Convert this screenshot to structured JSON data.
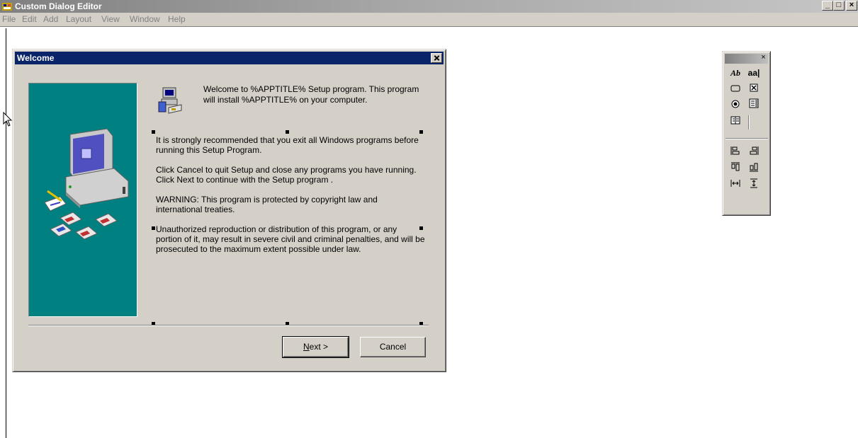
{
  "window": {
    "title": "Custom Dialog Editor",
    "buttons": {
      "minimize": "_",
      "maximize": "□",
      "close": "×"
    }
  },
  "menu": [
    "File",
    "Edit",
    "Add",
    "Layout",
    "View",
    "Window",
    "Help"
  ],
  "dialog": {
    "title": "Welcome",
    "welcome_text": "Welcome to %APPTITLE% Setup program. This program will install %APPTITLE% on your computer.",
    "paragraphs": [
      "It is strongly recommended that you exit all Windows programs before running this Setup Program.",
      "Click Cancel to quit Setup and close any programs you have running.  Click Next to continue with the Setup program .",
      "WARNING: This program is protected by copyright law and international treaties.",
      "Unauthorized reproduction or distribution of this program, or any portion of it, may result in severe civil and criminal penalties, and will be prosecuted to the maximum extent possible under law."
    ],
    "next_button": {
      "mnemonic": "N",
      "rest": "ext >"
    },
    "cancel_button": "Cancel"
  },
  "palette": {
    "tools": {
      "static_text": "Ab",
      "edit_text": "aa|"
    },
    "close": "×"
  },
  "colors": {
    "titlebar_active": "#0a246a",
    "face": "#d4d0c8",
    "teal": "#008080"
  }
}
